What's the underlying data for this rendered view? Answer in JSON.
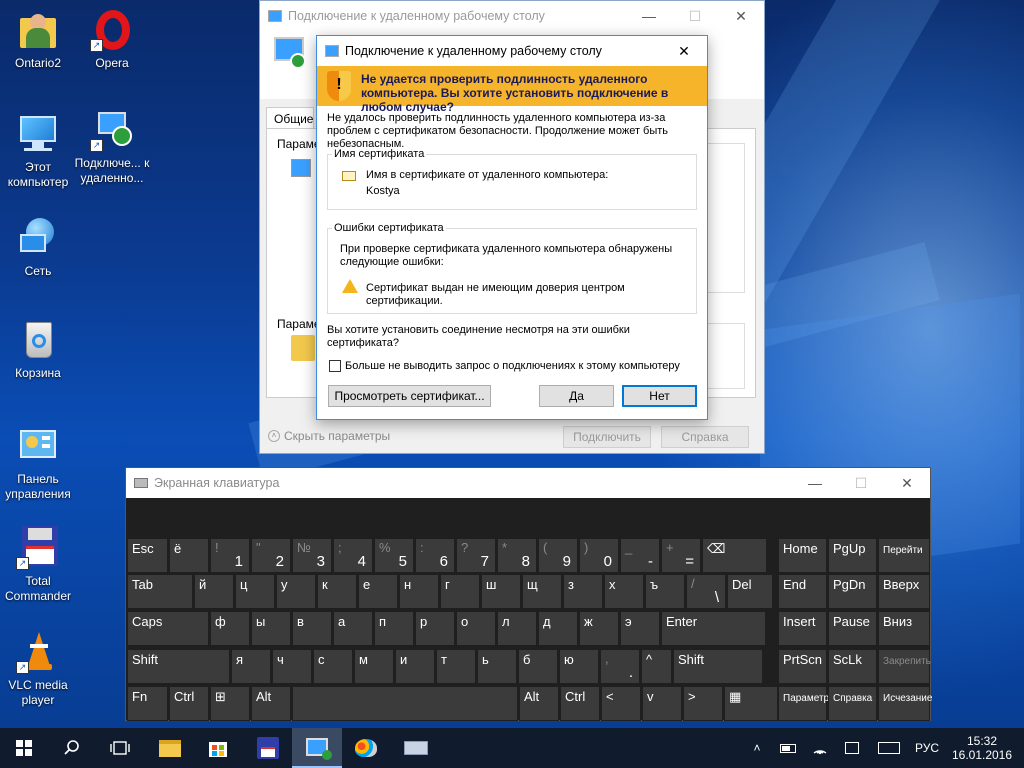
{
  "desktop_icons": [
    {
      "label": "Ontario2",
      "icon": "user-folder-icon"
    },
    {
      "label": "Opera",
      "icon": "opera-icon"
    },
    {
      "label": "Этот компьютер",
      "icon": "computer-icon"
    },
    {
      "label": "Подключе... к удаленно...",
      "icon": "remote-desktop-icon"
    },
    {
      "label": "Сеть",
      "icon": "network-icon"
    },
    {
      "label": "Корзина",
      "icon": "recycle-bin-icon"
    },
    {
      "label": "Панель управления",
      "icon": "control-panel-icon"
    },
    {
      "label": "Total Commander",
      "icon": "floppy-icon"
    },
    {
      "label": "VLC media player",
      "icon": "vlc-icon"
    }
  ],
  "rdp_main": {
    "title": "Подключение к удаленному рабочему столу",
    "tab_general": "Общие",
    "params1": "Параме",
    "params2": "Параме",
    "hide_params": "Скрыть параметры",
    "connect": "Подключить",
    "help": "Справка"
  },
  "dialog": {
    "title": "Подключение к удаленному рабочему столу",
    "warning": "Не удается проверить подлинность удаленного компьютера. Вы хотите установить подключение в любом случае?",
    "intro": "Не удалось проверить подлинность удаленного компьютера из-за проблем с сертификатом безопасности. Продолжение может быть небезопасным.",
    "cert_name_group": "Имя сертификата",
    "cert_name_label": "Имя в сертификате от удаленного компьютера:",
    "cert_name_value": "Kostya",
    "cert_errors_group": "Ошибки сертификата",
    "cert_errors_intro": "При проверке сертификата удаленного компьютера обнаружены следующие ошибки:",
    "cert_error_1": "Сертификат выдан не имеющим доверия центром сертификации.",
    "question": "Вы хотите установить соединение несмотря на эти ошибки сертификата?",
    "checkbox_label": "Больше не выводить запрос о подключениях к этому компьютеру",
    "view_cert": "Просмотреть сертификат...",
    "yes": "Да",
    "no": "Нет"
  },
  "osk": {
    "title": "Экранная клавиатура",
    "row1": [
      {
        "m": "Esc"
      },
      {
        "m": "ё"
      },
      {
        "s": "!",
        "b": "1"
      },
      {
        "s": "\"",
        "b": "2"
      },
      {
        "s": "№",
        "b": "3"
      },
      {
        "s": ";",
        "b": "4"
      },
      {
        "s": "%",
        "b": "5"
      },
      {
        "s": ":",
        "b": "6"
      },
      {
        "s": "?",
        "b": "7"
      },
      {
        "s": "*",
        "b": "8"
      },
      {
        "s": "(",
        "b": "9"
      },
      {
        "s": ")",
        "b": "0"
      },
      {
        "s": "_",
        "b": "-"
      },
      {
        "s": "+",
        "b": "="
      },
      {
        "m": "⌫"
      }
    ],
    "row2": [
      "Tab",
      "й",
      "ц",
      "у",
      "к",
      "е",
      "н",
      "г",
      "ш",
      "щ",
      "з",
      "х",
      "ъ",
      "/",
      "Del"
    ],
    "row2_slash_bottom": "\\",
    "row3": [
      "Caps",
      "ф",
      "ы",
      "в",
      "а",
      "п",
      "р",
      "о",
      "л",
      "д",
      "ж",
      "э",
      "Enter"
    ],
    "row4": [
      "Shift",
      "я",
      "ч",
      "с",
      "м",
      "и",
      "т",
      "ь",
      "б",
      "ю",
      ",",
      "^",
      "Shift"
    ],
    "row4_comma_bottom": ".",
    "row5": [
      "Fn",
      "Ctrl",
      "⊞",
      "Alt",
      "",
      "Alt",
      "Ctrl",
      "<",
      "v",
      ">",
      "▦"
    ],
    "nav": [
      [
        "Home",
        "PgUp",
        "Перейти"
      ],
      [
        "End",
        "PgDn",
        "Вверх"
      ],
      [
        "Insert",
        "Pause",
        "Вниз"
      ],
      [
        "PrtScn",
        "ScLk",
        "Закрепить"
      ],
      [
        "Параметры",
        "Справка",
        "Исчезание"
      ]
    ]
  },
  "taskbar": {
    "lang": "РУС",
    "time": "15:32",
    "date": "16.01.2016"
  }
}
